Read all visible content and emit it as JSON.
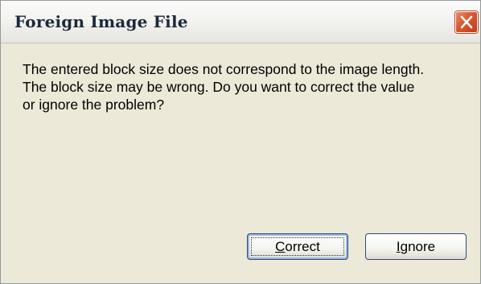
{
  "dialog": {
    "title": "Foreign Image File",
    "message": "The entered block size does not correspond to the image length.\nThe block size may be wrong. Do you want to correct the value\nor ignore the problem?",
    "close_icon": "close-icon",
    "buttons": {
      "correct": {
        "mnemonic": "C",
        "rest": "orrect"
      },
      "ignore": {
        "mnemonic": "I",
        "rest": "gnore"
      }
    }
  }
}
